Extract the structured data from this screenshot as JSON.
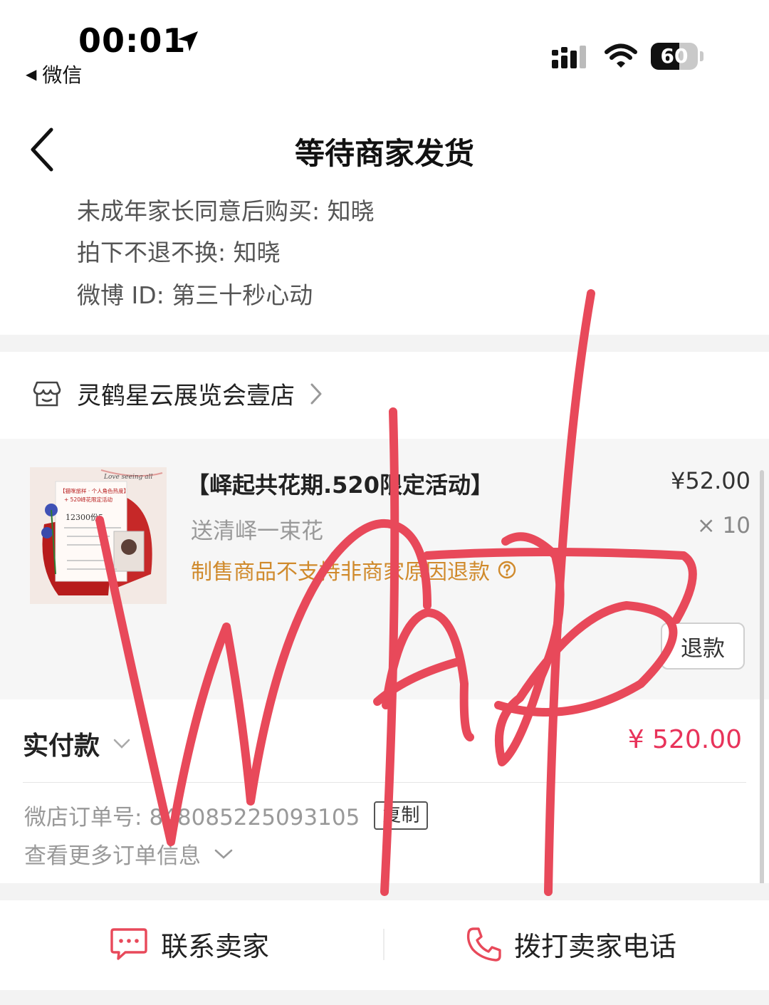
{
  "status_bar": {
    "time": "00:01",
    "back_app": "微信",
    "battery": "60",
    "battery_level": 0.6
  },
  "nav": {
    "title": "等待商家发货"
  },
  "order_notes": [
    "未成年家长同意后购买: 知晓",
    "拍下不退不换: 知晓",
    "微博 ID: 第三十秒心动"
  ],
  "shop": {
    "name": "灵鹤星云展览会壹店"
  },
  "product": {
    "title": "【峄起共花期.520限定活动】",
    "subtitle": "送清峄一束花",
    "notice": "制售商品不支持非商家原因退款",
    "price": "¥52.00",
    "quantity": "× 10",
    "refund_label": "退款",
    "image_texts": {
      "banner": "【猫咪旅样 · 个人角色热度】",
      "banner2": "+ 520峄花限定活动",
      "count": "12300份5",
      "cursive": "Love seeing all"
    }
  },
  "payment": {
    "label": "实付款",
    "amount": "¥ 520.00"
  },
  "order": {
    "number_label": "微店订单号:",
    "number": "848085225093105",
    "copy_label": "复制",
    "more_label": "查看更多订单信息"
  },
  "bottom": {
    "contact_label": "联系卖家",
    "call_label": "拨打卖家电话"
  },
  "colors": {
    "accent_red": "#e8335a",
    "notice_orange": "#d08a2c",
    "signature_red": "#e8495a"
  }
}
